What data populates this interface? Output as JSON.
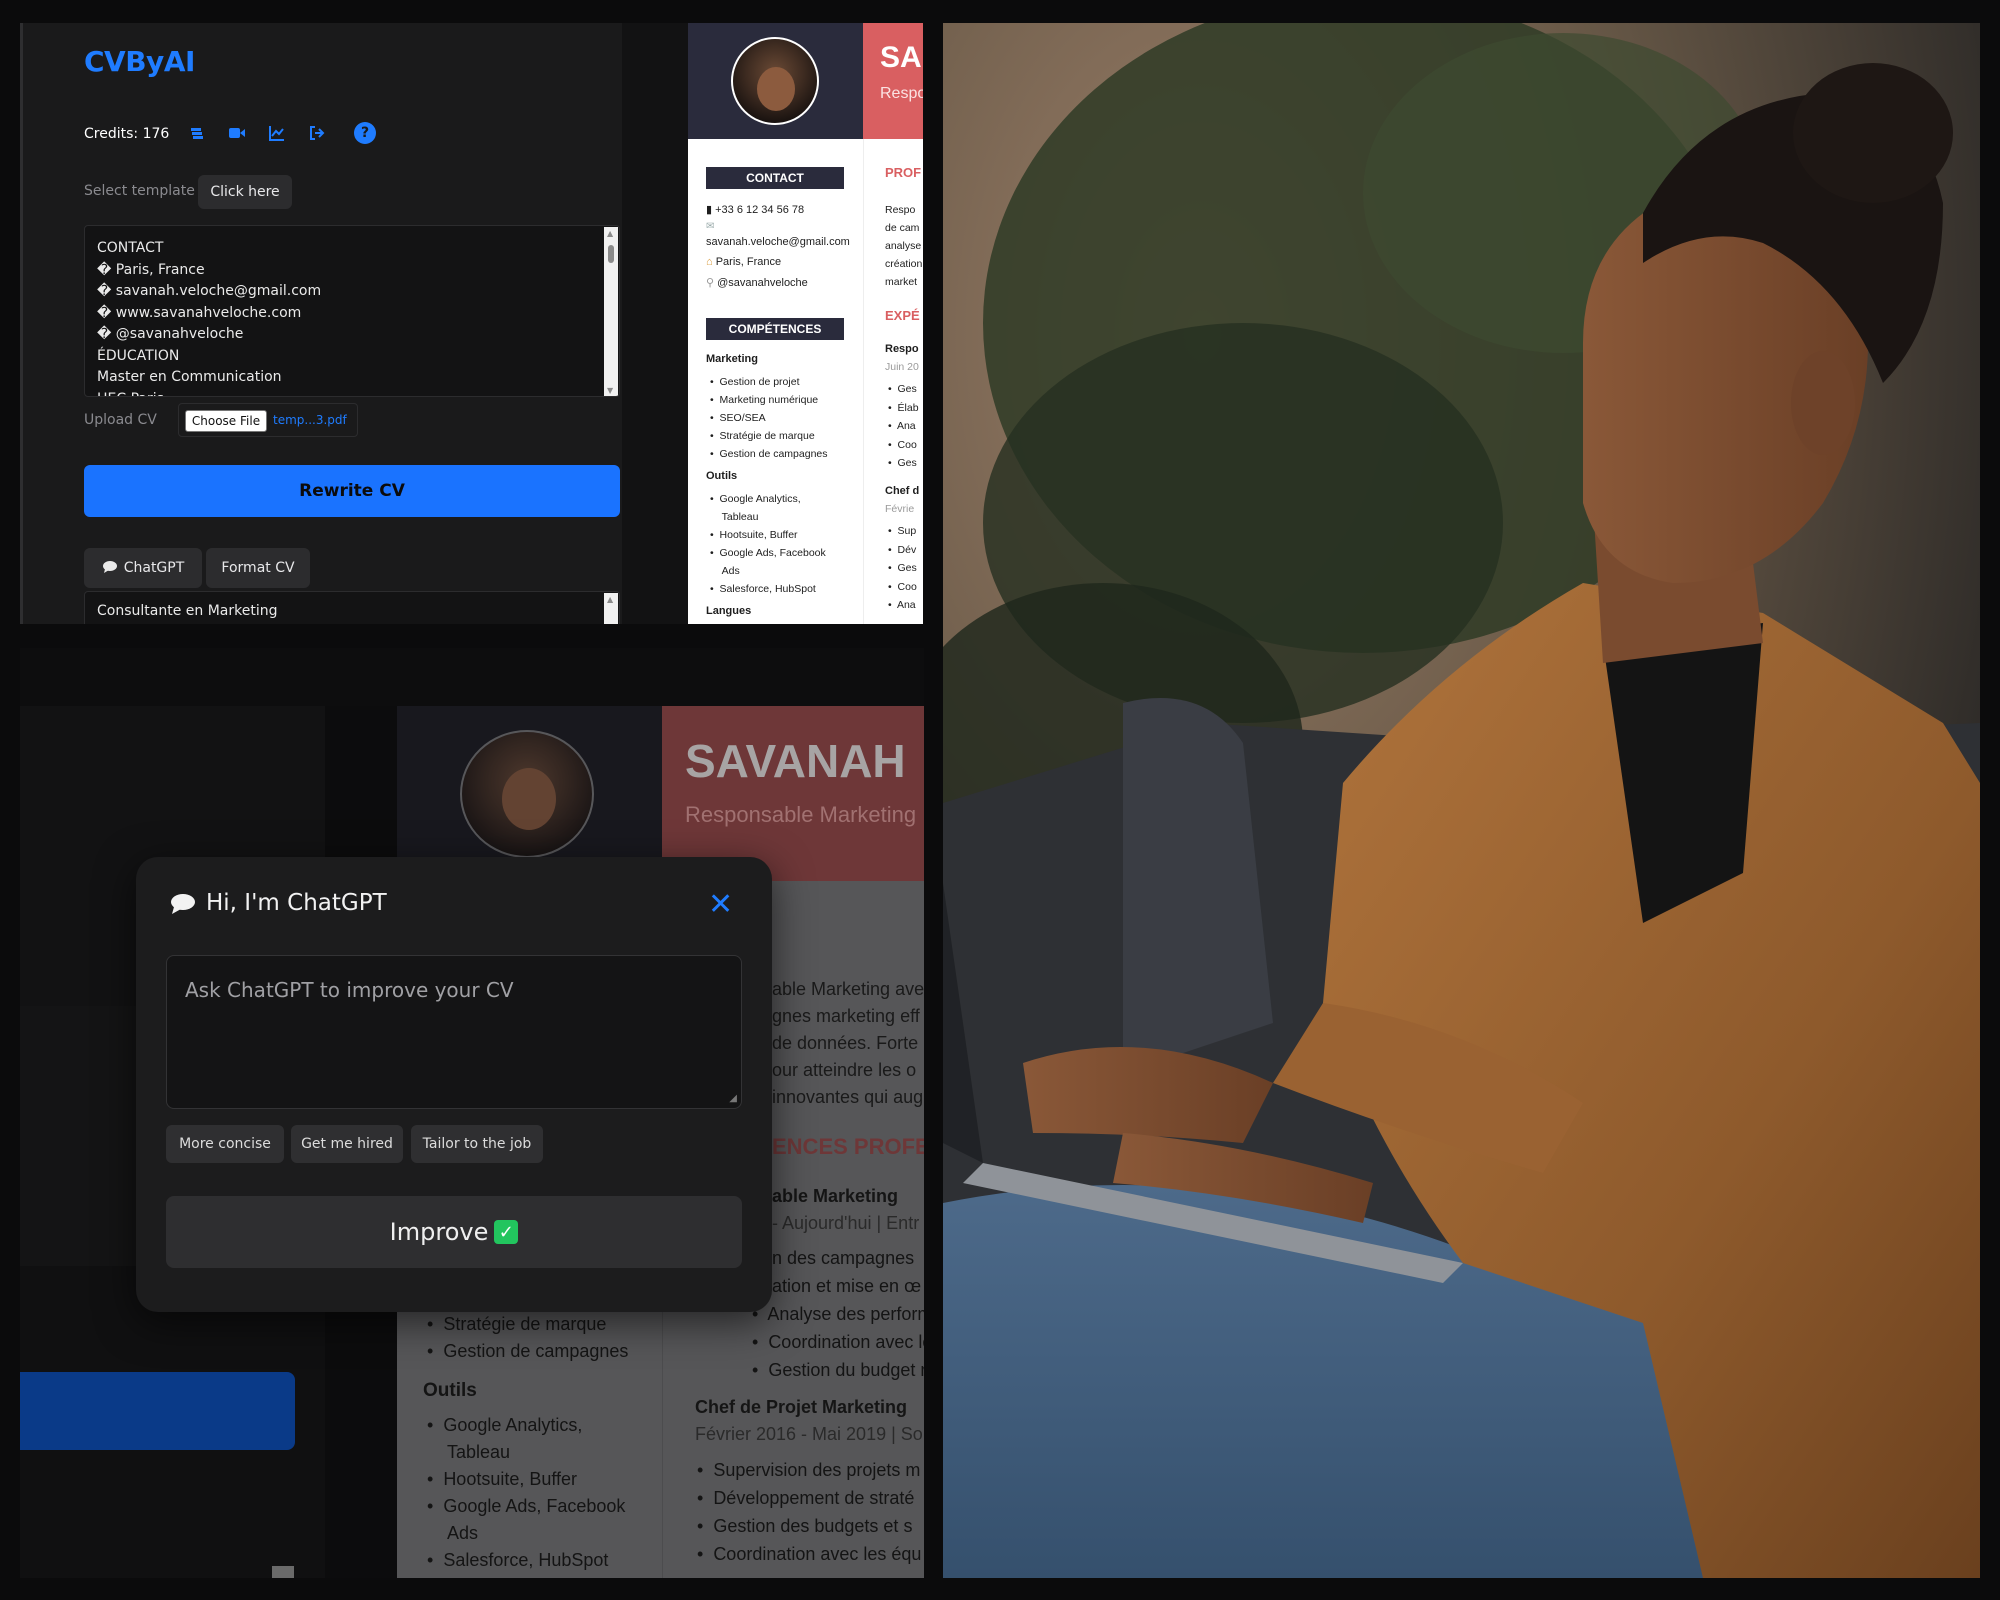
{
  "app": {
    "logo": "CVByAI",
    "credits": "Credits: 176",
    "icons": [
      "credits-stack-icon",
      "video-icon",
      "chart-line-icon",
      "logout-icon",
      "help-icon"
    ],
    "help_glyph": "?",
    "select_template_label": "Select template",
    "select_template_button": "Click here",
    "cv_text_lines": [
      "CONTACT",
      "� Paris, France",
      "� savanah.veloche@gmail.com",
      "� www.savanahveloche.com",
      "� @savanahveloche",
      "ÉDUCATION",
      "Master en Communication",
      "HEC Paris"
    ],
    "upload_label": "Upload CV",
    "choose_file": "Choose File",
    "file_name": "temp...3.pdf",
    "rewrite_button": "Rewrite CV",
    "tabs": [
      {
        "label": "ChatGPT",
        "icon": "chat-bubble-icon"
      },
      {
        "label": "Format CV"
      }
    ],
    "output_first_line": "Consultante en Marketing"
  },
  "cv_preview": {
    "name_partial": "SA",
    "role_partial": "Respo",
    "contact_heading": "CONTACT",
    "contact": [
      {
        "icon": "phone-icon",
        "text": "+33 6 12 34 56 78"
      },
      {
        "icon": "mail-icon",
        "text": "savanah.veloche@gmail.com"
      },
      {
        "icon": "home-icon",
        "text": "Paris, France"
      },
      {
        "icon": "link-icon",
        "text": "@savanahveloche"
      }
    ],
    "skills_heading": "COMPÉTENCES",
    "skill_groups": [
      {
        "title": "Marketing",
        "items": [
          "Gestion de projet",
          "Marketing numérique",
          "SEO/SEA",
          "Stratégie de marque",
          "Gestion de campagnes"
        ]
      },
      {
        "title": "Outils",
        "items": [
          "Google Analytics,",
          "Tableau",
          "Hootsuite, Buffer",
          "Google Ads, Facebook",
          "Ads",
          "Salesforce, HubSpot"
        ]
      }
    ],
    "languages_heading": "Langues",
    "right_headings": [
      "PROF",
      "EXPÉ"
    ],
    "right_text": [
      "Respo",
      "de cam",
      "analyse",
      "création",
      "market"
    ],
    "job1_title": "Respo",
    "job1_date": "Juin 20",
    "job1_bullets": [
      "Ges",
      "Élab",
      "Ana",
      "Coo",
      "Ges"
    ],
    "job2_title": "Chef d",
    "job2_date": "Févrie",
    "job2_bullets": [
      "Sup",
      "Dév",
      "Ges",
      "Coo",
      "Ana"
    ]
  },
  "bottom_cv": {
    "name": "SAVANAH",
    "role": "Responsable Marketing",
    "profile_lines": [
      "able Marketing avec",
      "gnes marketing eff",
      "de données. Forte",
      "our atteindre les o",
      "innovantes qui aug"
    ],
    "section_heading": "ENCES PROFE",
    "job1_title": "able Marketing",
    "job1_date": "- Aujourd'hui | Entr",
    "job1_bullets": [
      "n des campagnes",
      "ation et mise en œ",
      "Analyse des performance",
      "Coordination avec les équ",
      "Gestion du budget marke"
    ],
    "job2_title": "Chef de Projet Marketing",
    "job2_date": "Février 2016 - Mai 2019 | So",
    "job2_bullets": [
      "Supervision des projets m",
      "Développement de straté",
      "Gestion des budgets et s",
      "Coordination avec les équ"
    ],
    "left_items": [
      "Stratégie de marque",
      "Gestion de campagnes"
    ],
    "tools_heading": "Outils",
    "tools": [
      "Google Analytics,",
      "Tableau",
      "Hootsuite, Buffer",
      "Google Ads, Facebook",
      "Ads",
      "Salesforce, HubSpot"
    ]
  },
  "chat_modal": {
    "title": "Hi, I'm ChatGPT",
    "close_glyph": "✕",
    "placeholder": "Ask ChatGPT to improve your CV",
    "chips": [
      "More concise",
      "Get me hired",
      "Tailor to the job"
    ],
    "improve_button": "Improve",
    "improve_check": "✓"
  },
  "colors": {
    "accent": "#1f7cff",
    "cv_red": "#d95f61",
    "cv_navy": "#2a2b3c",
    "panel": "#1a1a1b"
  }
}
